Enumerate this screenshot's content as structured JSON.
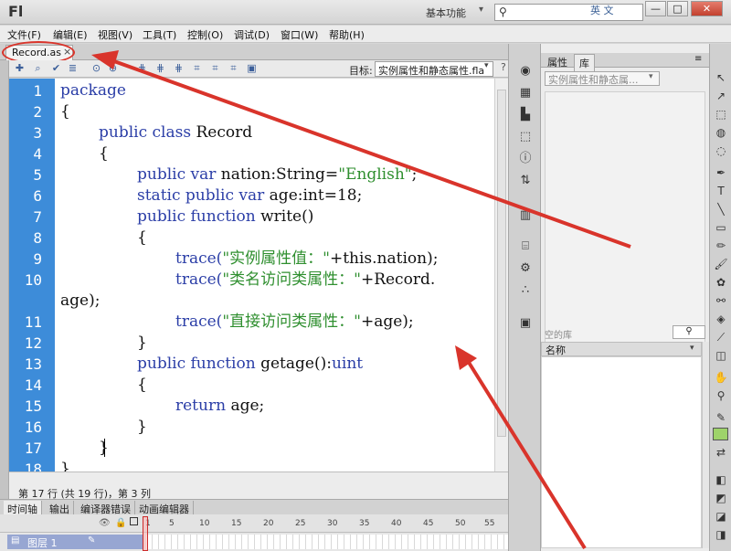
{
  "window": {
    "app_logo": "Fl",
    "workspace": "基本功能",
    "search_lang": "英 文",
    "min_label": "—",
    "max_label": "□",
    "close_label": "✕"
  },
  "menu": [
    "文件(F)",
    "编辑(E)",
    "视图(V)",
    "工具(T)",
    "控制(O)",
    "调试(D)",
    "窗口(W)",
    "帮助(H)"
  ],
  "document_tab": {
    "label": "Record.as",
    "close": "×"
  },
  "editor_toolbar": {
    "target_label": "目标:",
    "target_value": "实例属性和静态属性.fla",
    "help": "?"
  },
  "code_lines": [
    {
      "n": "1",
      "indent": 0,
      "parts": [
        {
          "t": "package",
          "c": "kw"
        }
      ]
    },
    {
      "n": "2",
      "indent": 0,
      "parts": [
        {
          "t": "{",
          "c": ""
        }
      ]
    },
    {
      "n": "3",
      "indent": 1,
      "parts": [
        {
          "t": "public class ",
          "c": "kw"
        },
        {
          "t": "Record",
          "c": ""
        }
      ]
    },
    {
      "n": "4",
      "indent": 1,
      "parts": [
        {
          "t": "{",
          "c": ""
        }
      ]
    },
    {
      "n": "5",
      "indent": 2,
      "parts": [
        {
          "t": "public var ",
          "c": "kw"
        },
        {
          "t": "nation:String=",
          "c": ""
        },
        {
          "t": "\"English\"",
          "c": "str"
        },
        {
          "t": ";",
          "c": ""
        }
      ]
    },
    {
      "n": "6",
      "indent": 2,
      "parts": [
        {
          "t": "static public var ",
          "c": "kw"
        },
        {
          "t": "age:int=18;",
          "c": ""
        }
      ]
    },
    {
      "n": "7",
      "indent": 2,
      "parts": [
        {
          "t": "public function ",
          "c": "kw"
        },
        {
          "t": "write()",
          "c": ""
        }
      ]
    },
    {
      "n": "8",
      "indent": 2,
      "parts": [
        {
          "t": "{",
          "c": ""
        }
      ]
    },
    {
      "n": "9",
      "indent": 3,
      "parts": [
        {
          "t": "trace(",
          "c": "kw"
        },
        {
          "t": "\"实例属性值：\"",
          "c": "str"
        },
        {
          "t": "+this.nation);",
          "c": ""
        }
      ]
    },
    {
      "n": "10",
      "indent": 3,
      "parts": [
        {
          "t": "trace(",
          "c": "kw"
        },
        {
          "t": "\"类名访问类属性：\"",
          "c": "str"
        },
        {
          "t": "+Record.",
          "c": ""
        }
      ]
    },
    {
      "n": "",
      "indent": 0,
      "parts": [
        {
          "t": "age);",
          "c": ""
        }
      ]
    },
    {
      "n": "11",
      "indent": 3,
      "parts": [
        {
          "t": "trace(",
          "c": "kw"
        },
        {
          "t": "\"直接访问类属性：\"",
          "c": "str"
        },
        {
          "t": "+age);",
          "c": ""
        }
      ]
    },
    {
      "n": "12",
      "indent": 2,
      "parts": [
        {
          "t": "}",
          "c": ""
        }
      ]
    },
    {
      "n": "13",
      "indent": 2,
      "parts": [
        {
          "t": "public function ",
          "c": "kw"
        },
        {
          "t": "getage():",
          "c": ""
        },
        {
          "t": "uint",
          "c": "kw"
        }
      ]
    },
    {
      "n": "14",
      "indent": 2,
      "parts": [
        {
          "t": "{",
          "c": ""
        }
      ]
    },
    {
      "n": "15",
      "indent": 3,
      "parts": [
        {
          "t": "return ",
          "c": "kw"
        },
        {
          "t": "age;",
          "c": ""
        }
      ]
    },
    {
      "n": "16",
      "indent": 2,
      "parts": [
        {
          "t": "}",
          "c": ""
        }
      ]
    },
    {
      "n": "17",
      "indent": 1,
      "parts": [
        {
          "t": "}",
          "c": ""
        }
      ]
    },
    {
      "n": "18",
      "indent": 0,
      "parts": [
        {
          "t": "}",
          "c": ""
        }
      ]
    }
  ],
  "status": "第 17 行 (共 19 行)，第 3 列",
  "timeline": {
    "tabs": [
      "时间轴",
      "输出",
      "编译器错误",
      "动画编辑器"
    ],
    "ruler": [
      "1",
      "5",
      "10",
      "15",
      "20",
      "25",
      "30",
      "35",
      "40",
      "45",
      "50",
      "55"
    ],
    "layer_name": "图层 1"
  },
  "right_panel": {
    "tabs": [
      "属性",
      "库"
    ],
    "library_select": "实例属性和静态属...",
    "empty_label": "空的库",
    "column_name": "名称"
  },
  "colors": {
    "accent": "#3d8cd9",
    "annotation": "#d9342b",
    "keyword": "#2b3ea7",
    "string": "#2f8f2f"
  }
}
